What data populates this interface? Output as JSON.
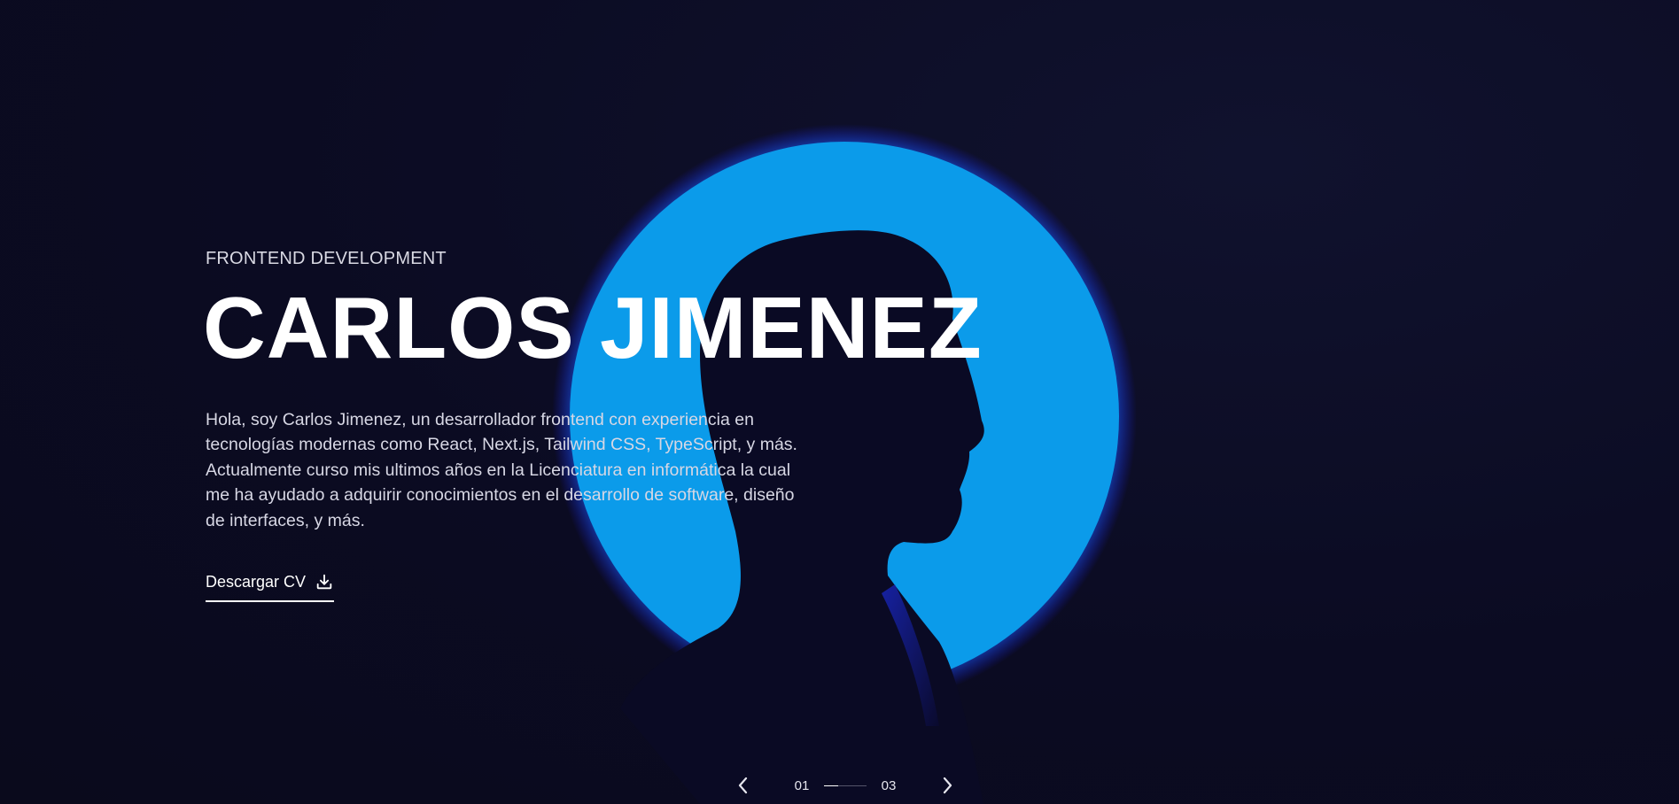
{
  "hero": {
    "eyebrow": "FRONTEND DEVELOPMENT",
    "name": "CARLOS JIMENEZ",
    "bio": "Hola, soy Carlos Jimenez, un desarrollador frontend con experiencia en tecnologías modernas como React, Next.js, Tailwind CSS, TypeScript, y más. Actualmente curso mis ultimos años en la Licenciatura en informática la cual me ha ayudado a adquirir conocimientos en el desarrollo de software, diseño de interfaces, y más.",
    "cv_button": {
      "label": "Descargar CV",
      "icon": "download-icon"
    }
  },
  "slider": {
    "current": "01",
    "total": "03",
    "progress": 0.33,
    "prev_icon": "chevron-left-icon",
    "next_icon": "chevron-right-icon"
  },
  "colors": {
    "background": "#0b0b22",
    "accent_circle": "#0b9bea",
    "text": "#ffffff",
    "muted_text": "#d7d7e4"
  }
}
